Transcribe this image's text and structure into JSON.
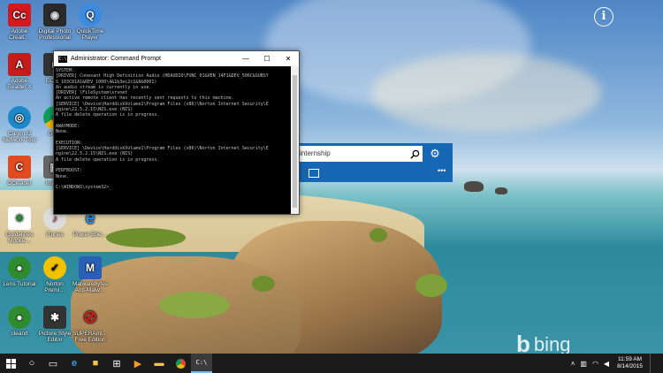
{
  "desktop": {
    "icons": [
      {
        "label": "Adobe Creati…",
        "glyph": "Cc",
        "color": "#d4181f"
      },
      {
        "label": "Digital Photo Professional",
        "glyph": "◉",
        "color": "#2a2a2a"
      },
      {
        "label": "QuickTime Player",
        "glyph": "Q",
        "color": "#3b8be0"
      },
      {
        "label": "Adobe Reader X",
        "glyph": "A",
        "color": "#c61b1b"
      },
      {
        "label": "EOS…",
        "glyph": "■",
        "color": "#333333"
      },
      {
        "label": "Canon IJ Network Tool",
        "glyph": "◎",
        "color": "#1d88c9"
      },
      {
        "label": "Go…",
        "glyph": "●",
        "color": "#e8a31a"
      },
      {
        "label": "CCleaner",
        "glyph": "C",
        "color": "#e24b1f"
      },
      {
        "label": "Imag…",
        "glyph": "▣",
        "color": "#666666"
      },
      {
        "label": "Guidelines Mobile…",
        "glyph": "✳",
        "color": "#ffffff"
      },
      {
        "label": "iTunes",
        "glyph": "♪",
        "color": "#cccccc"
      },
      {
        "label": "Power Brie…",
        "glyph": "e",
        "color": "#ffffff"
      },
      {
        "label": "Lens Tutorial",
        "glyph": "●",
        "color": "#2e8b2e"
      },
      {
        "label": "Norton Premi…",
        "glyph": "✓",
        "color": "#f2c200"
      },
      {
        "label": "Malwarebytes Anti-Malw…",
        "glyph": "M",
        "color": "#2a5fb8"
      },
      {
        "label": "cleanit",
        "glyph": "●",
        "color": "#2e8b2e"
      },
      {
        "label": "Picture Style Editor",
        "glyph": "✱",
        "color": "#333333"
      },
      {
        "label": "SUPERAnti… Free Edition",
        "glyph": "⊘",
        "color": "#cc1f1f"
      }
    ]
  },
  "cmd": {
    "title": "Administrator: Command Prompt",
    "lines": [
      "SYSTEM:",
      "[DRIVER] Conexant High Definition Audio (HDAUDIO\\FUNC_01&VEN_14F1&DEV_506C&SUBSY",
      "S_103C81A1&REV_1000\\4&1b3ec2c1&0&0001)",
      "An audio stream is currently in use.",
      "[DRIVER] \\FileSystem\\srvnet",
      "An active remote client has recently sent requests to this machine.",
      "[SERVICE] \\Device\\HarddiskVolume1\\Program Files (x86)\\Norton Internet Security\\E",
      "ngine\\22.5.2.15\\NIS.exe (NIS)",
      "A file delete operation is in progress.",
      "",
      "AWAYMODE:",
      "None.",
      "",
      "EXECUTION:",
      "[SERVICE] \\Device\\HarddiskVolume1\\Program Files (x86)\\Norton Internet Security\\E",
      "ngine\\22.5.2.15\\NIS.exe (NIS)",
      "A file delete operation is in progress.",
      "",
      "PERFBOOST:",
      "None.",
      "",
      "C:\\WINDOWS\\system32>_"
    ]
  },
  "search": {
    "value": "internship"
  },
  "bing": "bing",
  "taskbar": {
    "time": "11:59 AM",
    "date": "8/14/2015"
  }
}
